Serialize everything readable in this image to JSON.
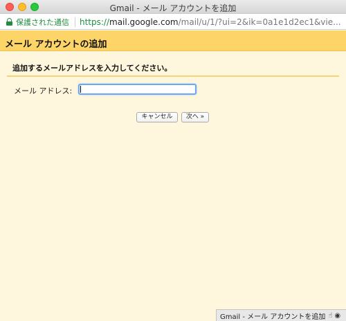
{
  "window": {
    "title": "Gmail - メール アカウントを追加"
  },
  "address_bar": {
    "security_label": "保護された通信",
    "url_scheme": "https://",
    "url_host": "mail.google.com",
    "url_path": "/mail/u/1/?ui=2&ik=0a1e1d2ec1&vie..."
  },
  "page": {
    "header_title": "メール アカウントの追加",
    "instruction": "追加するメールアドレスを入力してください。",
    "email_label": "メール アドレス:",
    "email_value": "",
    "cancel_label": "キャンセル",
    "next_label": "次へ »"
  },
  "status_bar": {
    "text": "Gmail - メール アカウントを追加",
    "icons": [
      "hand-pointer-icon",
      "eye-icon"
    ]
  },
  "colors": {
    "header_bg": "#fdd467",
    "page_bg": "#fff7dd",
    "secure_green": "#1e8e3e",
    "input_focus": "#6aa7f5"
  }
}
